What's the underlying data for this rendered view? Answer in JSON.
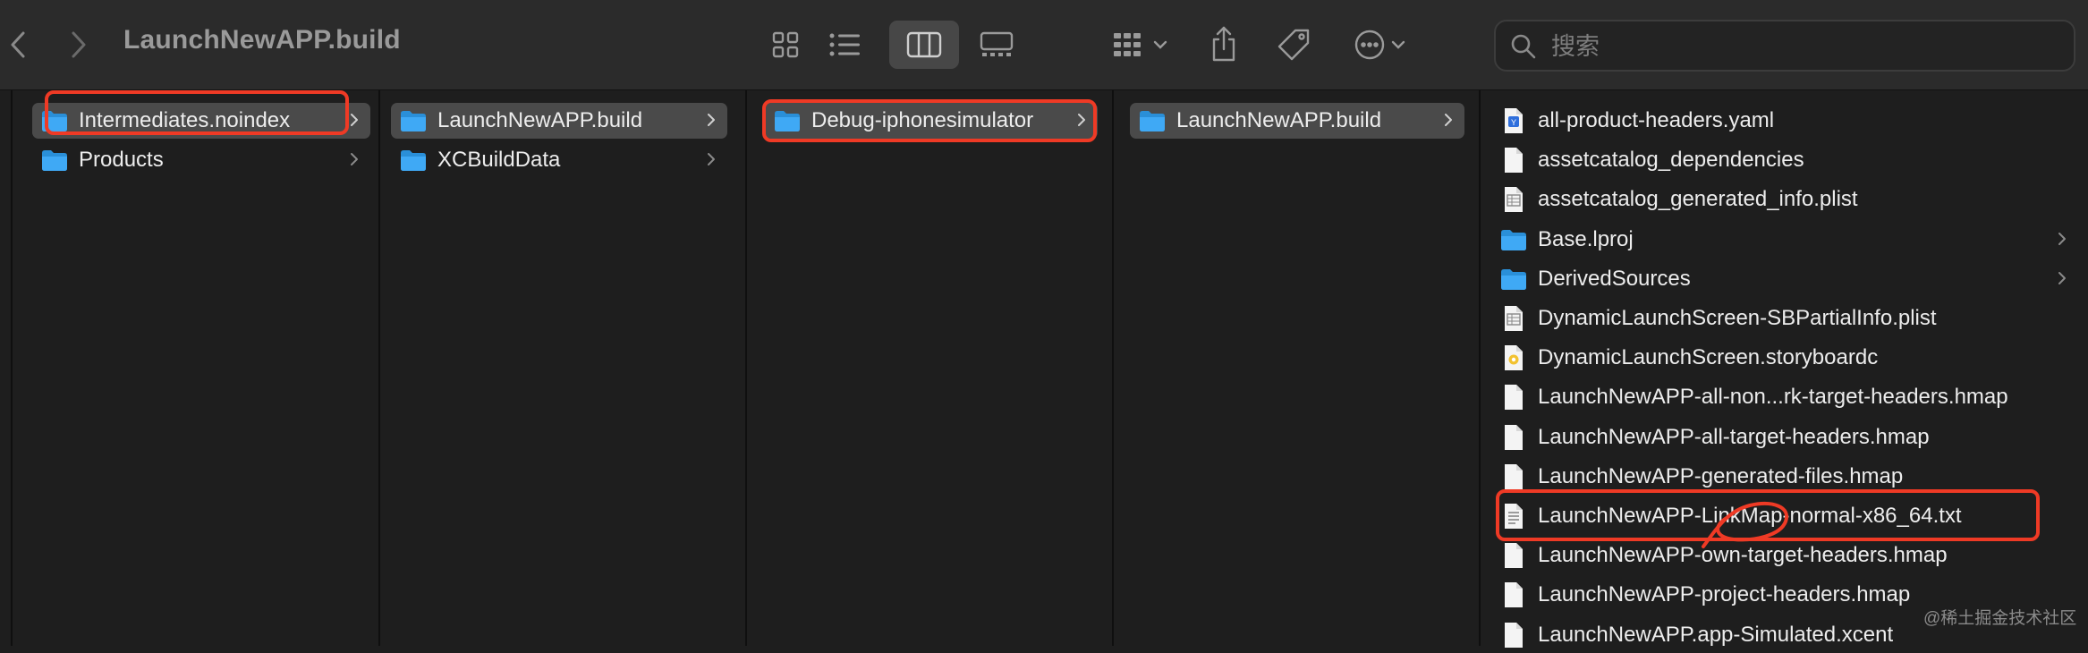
{
  "window": {
    "title": "LaunchNewAPP.build"
  },
  "search": {
    "placeholder": "搜索"
  },
  "columns": [
    {
      "items": [
        {
          "label": "Intermediates.noindex",
          "kind": "folder",
          "selected": true,
          "chevron": true
        },
        {
          "label": "Products",
          "kind": "folder",
          "selected": false,
          "chevron": true
        }
      ]
    },
    {
      "items": [
        {
          "label": "LaunchNewAPP.build",
          "kind": "folder",
          "selected": true,
          "chevron": true
        },
        {
          "label": "XCBuildData",
          "kind": "folder",
          "selected": false,
          "chevron": true
        }
      ]
    },
    {
      "items": [
        {
          "label": "Debug-iphonesimulator",
          "kind": "folder",
          "selected": true,
          "chevron": true
        }
      ]
    },
    {
      "items": [
        {
          "label": "LaunchNewAPP.build",
          "kind": "folder",
          "selected": true,
          "chevron": true
        }
      ]
    },
    {
      "items": [
        {
          "label": "all-product-headers.yaml",
          "kind": "yaml-file",
          "chevron": false
        },
        {
          "label": "assetcatalog_dependencies",
          "kind": "file",
          "chevron": false
        },
        {
          "label": "assetcatalog_generated_info.plist",
          "kind": "plist-file",
          "chevron": false
        },
        {
          "label": "Base.lproj",
          "kind": "folder",
          "chevron": true
        },
        {
          "label": "DerivedSources",
          "kind": "folder",
          "chevron": true
        },
        {
          "label": "DynamicLaunchScreen-SBPartialInfo.plist",
          "kind": "plist-file",
          "chevron": false
        },
        {
          "label": "DynamicLaunchScreen.storyboardc",
          "kind": "storyboard-file",
          "chevron": false
        },
        {
          "label": "LaunchNewAPP-all-non...rk-target-headers.hmap",
          "kind": "file",
          "chevron": false
        },
        {
          "label": "LaunchNewAPP-all-target-headers.hmap",
          "kind": "file",
          "chevron": false
        },
        {
          "label": "LaunchNewAPP-generated-files.hmap",
          "kind": "file",
          "chevron": false
        },
        {
          "label": "LaunchNewAPP-LinkMap-normal-x86_64.txt",
          "kind": "text-file",
          "chevron": false
        },
        {
          "label": "LaunchNewAPP-own-target-headers.hmap",
          "kind": "file",
          "chevron": false
        },
        {
          "label": "LaunchNewAPP-project-headers.hmap",
          "kind": "file",
          "chevron": false
        },
        {
          "label": "LaunchNewAPP.app-Simulated.xcent",
          "kind": "file",
          "chevron": false
        }
      ]
    }
  ],
  "watermark": "@稀土掘金技术社区",
  "colors": {
    "annotation": "#ef3a25",
    "folder": "#3fa9f5",
    "background": "#1e1e1e",
    "toolbar": "#2b2b2b"
  }
}
